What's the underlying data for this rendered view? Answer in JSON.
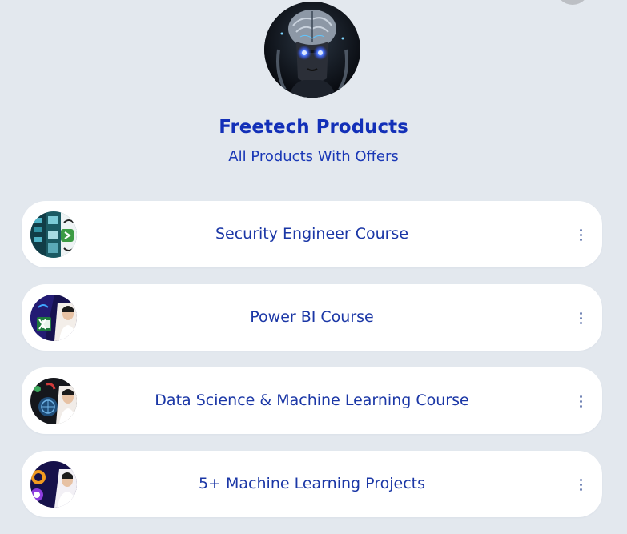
{
  "profile": {
    "name": "Freetech Products",
    "tagline": "All Products With Offers"
  },
  "links": [
    {
      "label": "Security Engineer Course",
      "thumbnail_icon": "security-course-thumbnail"
    },
    {
      "label": "Power BI Course",
      "thumbnail_icon": "power-bi-course-thumbnail"
    },
    {
      "label": "Data Science & Machine Learning Course",
      "thumbnail_icon": "data-science-course-thumbnail"
    },
    {
      "label": "5+ Machine Learning Projects",
      "thumbnail_icon": "ml-projects-thumbnail"
    }
  ],
  "colors": {
    "background": "#e3e8ee",
    "card": "#ffffff",
    "title": "#1330b8",
    "link_text": "#1b37a6"
  },
  "icons": {
    "more_menu": "vertical-dots-icon",
    "avatar": "cyber-brain-avatar"
  }
}
